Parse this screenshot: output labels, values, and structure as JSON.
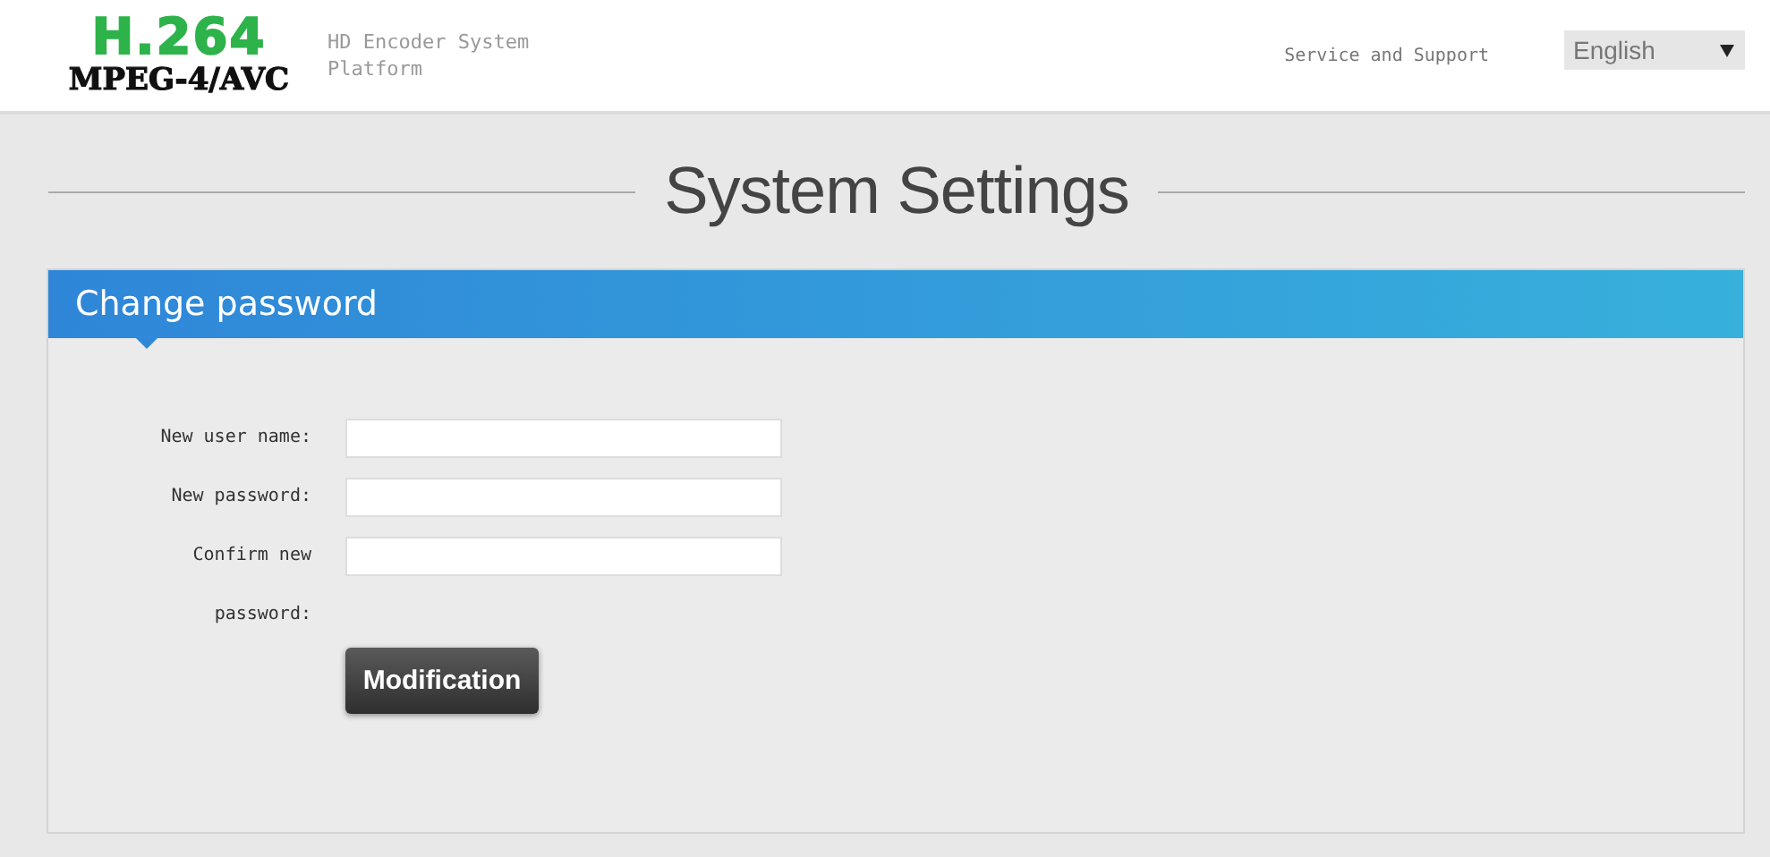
{
  "header": {
    "logo_top": "H.264",
    "logo_bottom": "MPEG-4/AVC",
    "subtitle": "HD Encoder System Platform",
    "support_link": "Service and Support",
    "language": {
      "value": "English"
    }
  },
  "page_title": "System Settings",
  "panel": {
    "title": "Change password",
    "fields": [
      {
        "label": "New user name:"
      },
      {
        "label": "New password:"
      },
      {
        "label": "Confirm new password:"
      }
    ],
    "button": "Modification"
  }
}
